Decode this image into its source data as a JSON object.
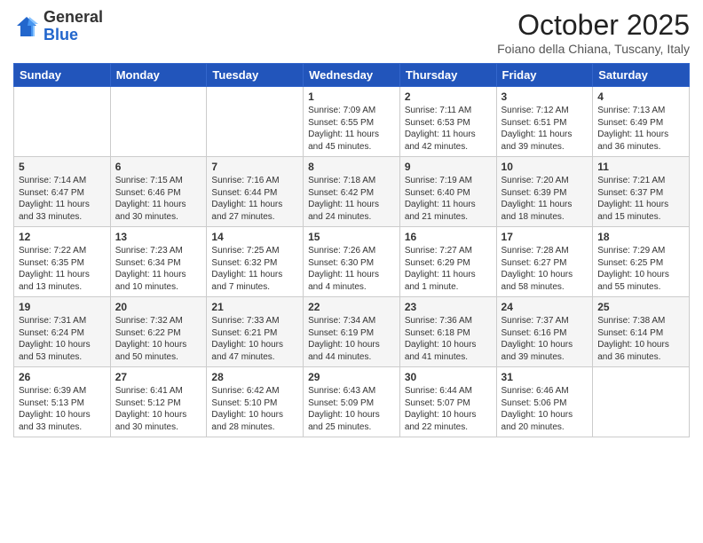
{
  "logo": {
    "general": "General",
    "blue": "Blue"
  },
  "header": {
    "title": "October 2025",
    "subtitle": "Foiano della Chiana, Tuscany, Italy"
  },
  "weekdays": [
    "Sunday",
    "Monday",
    "Tuesday",
    "Wednesday",
    "Thursday",
    "Friday",
    "Saturday"
  ],
  "weeks": [
    [
      {
        "day": "",
        "info": ""
      },
      {
        "day": "",
        "info": ""
      },
      {
        "day": "",
        "info": ""
      },
      {
        "day": "1",
        "info": "Sunrise: 7:09 AM\nSunset: 6:55 PM\nDaylight: 11 hours and 45 minutes."
      },
      {
        "day": "2",
        "info": "Sunrise: 7:11 AM\nSunset: 6:53 PM\nDaylight: 11 hours and 42 minutes."
      },
      {
        "day": "3",
        "info": "Sunrise: 7:12 AM\nSunset: 6:51 PM\nDaylight: 11 hours and 39 minutes."
      },
      {
        "day": "4",
        "info": "Sunrise: 7:13 AM\nSunset: 6:49 PM\nDaylight: 11 hours and 36 minutes."
      }
    ],
    [
      {
        "day": "5",
        "info": "Sunrise: 7:14 AM\nSunset: 6:47 PM\nDaylight: 11 hours and 33 minutes."
      },
      {
        "day": "6",
        "info": "Sunrise: 7:15 AM\nSunset: 6:46 PM\nDaylight: 11 hours and 30 minutes."
      },
      {
        "day": "7",
        "info": "Sunrise: 7:16 AM\nSunset: 6:44 PM\nDaylight: 11 hours and 27 minutes."
      },
      {
        "day": "8",
        "info": "Sunrise: 7:18 AM\nSunset: 6:42 PM\nDaylight: 11 hours and 24 minutes."
      },
      {
        "day": "9",
        "info": "Sunrise: 7:19 AM\nSunset: 6:40 PM\nDaylight: 11 hours and 21 minutes."
      },
      {
        "day": "10",
        "info": "Sunrise: 7:20 AM\nSunset: 6:39 PM\nDaylight: 11 hours and 18 minutes."
      },
      {
        "day": "11",
        "info": "Sunrise: 7:21 AM\nSunset: 6:37 PM\nDaylight: 11 hours and 15 minutes."
      }
    ],
    [
      {
        "day": "12",
        "info": "Sunrise: 7:22 AM\nSunset: 6:35 PM\nDaylight: 11 hours and 13 minutes."
      },
      {
        "day": "13",
        "info": "Sunrise: 7:23 AM\nSunset: 6:34 PM\nDaylight: 11 hours and 10 minutes."
      },
      {
        "day": "14",
        "info": "Sunrise: 7:25 AM\nSunset: 6:32 PM\nDaylight: 11 hours and 7 minutes."
      },
      {
        "day": "15",
        "info": "Sunrise: 7:26 AM\nSunset: 6:30 PM\nDaylight: 11 hours and 4 minutes."
      },
      {
        "day": "16",
        "info": "Sunrise: 7:27 AM\nSunset: 6:29 PM\nDaylight: 11 hours and 1 minute."
      },
      {
        "day": "17",
        "info": "Sunrise: 7:28 AM\nSunset: 6:27 PM\nDaylight: 10 hours and 58 minutes."
      },
      {
        "day": "18",
        "info": "Sunrise: 7:29 AM\nSunset: 6:25 PM\nDaylight: 10 hours and 55 minutes."
      }
    ],
    [
      {
        "day": "19",
        "info": "Sunrise: 7:31 AM\nSunset: 6:24 PM\nDaylight: 10 hours and 53 minutes."
      },
      {
        "day": "20",
        "info": "Sunrise: 7:32 AM\nSunset: 6:22 PM\nDaylight: 10 hours and 50 minutes."
      },
      {
        "day": "21",
        "info": "Sunrise: 7:33 AM\nSunset: 6:21 PM\nDaylight: 10 hours and 47 minutes."
      },
      {
        "day": "22",
        "info": "Sunrise: 7:34 AM\nSunset: 6:19 PM\nDaylight: 10 hours and 44 minutes."
      },
      {
        "day": "23",
        "info": "Sunrise: 7:36 AM\nSunset: 6:18 PM\nDaylight: 10 hours and 41 minutes."
      },
      {
        "day": "24",
        "info": "Sunrise: 7:37 AM\nSunset: 6:16 PM\nDaylight: 10 hours and 39 minutes."
      },
      {
        "day": "25",
        "info": "Sunrise: 7:38 AM\nSunset: 6:14 PM\nDaylight: 10 hours and 36 minutes."
      }
    ],
    [
      {
        "day": "26",
        "info": "Sunrise: 6:39 AM\nSunset: 5:13 PM\nDaylight: 10 hours and 33 minutes."
      },
      {
        "day": "27",
        "info": "Sunrise: 6:41 AM\nSunset: 5:12 PM\nDaylight: 10 hours and 30 minutes."
      },
      {
        "day": "28",
        "info": "Sunrise: 6:42 AM\nSunset: 5:10 PM\nDaylight: 10 hours and 28 minutes."
      },
      {
        "day": "29",
        "info": "Sunrise: 6:43 AM\nSunset: 5:09 PM\nDaylight: 10 hours and 25 minutes."
      },
      {
        "day": "30",
        "info": "Sunrise: 6:44 AM\nSunset: 5:07 PM\nDaylight: 10 hours and 22 minutes."
      },
      {
        "day": "31",
        "info": "Sunrise: 6:46 AM\nSunset: 5:06 PM\nDaylight: 10 hours and 20 minutes."
      },
      {
        "day": "",
        "info": ""
      }
    ]
  ]
}
